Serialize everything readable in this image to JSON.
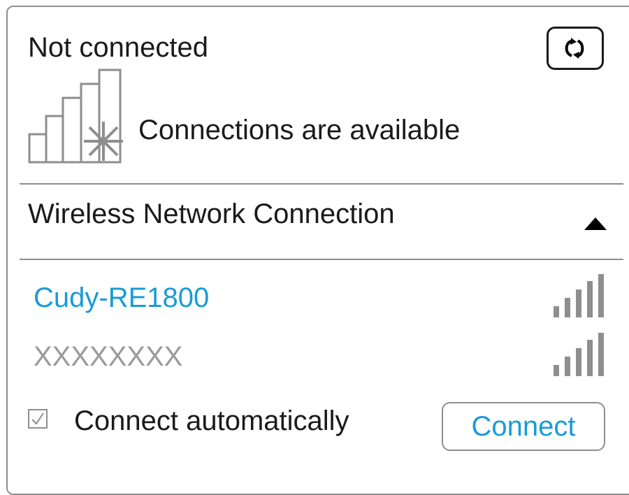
{
  "status": {
    "title": "Not connected",
    "availability_text": "Connections are available"
  },
  "section": {
    "title": "Wireless Network Connection"
  },
  "networks": [
    {
      "name": "Cudy-RE1800",
      "selected": true
    },
    {
      "name": "XXXXXXXX",
      "selected": false
    }
  ],
  "footer": {
    "auto_connect_label": "Connect automatically",
    "auto_connect_checked": true,
    "connect_button_label": "Connect"
  },
  "colors": {
    "accent": "#1a9bd8",
    "muted": "#9a9a9a",
    "border": "#8e8e8e"
  },
  "icons": {
    "refresh": "refresh-icon",
    "status": "signal-strength-icon",
    "collapse": "collapse-up-icon",
    "network_signal": "wifi-signal-icon",
    "checkbox": "checkmark-icon"
  }
}
